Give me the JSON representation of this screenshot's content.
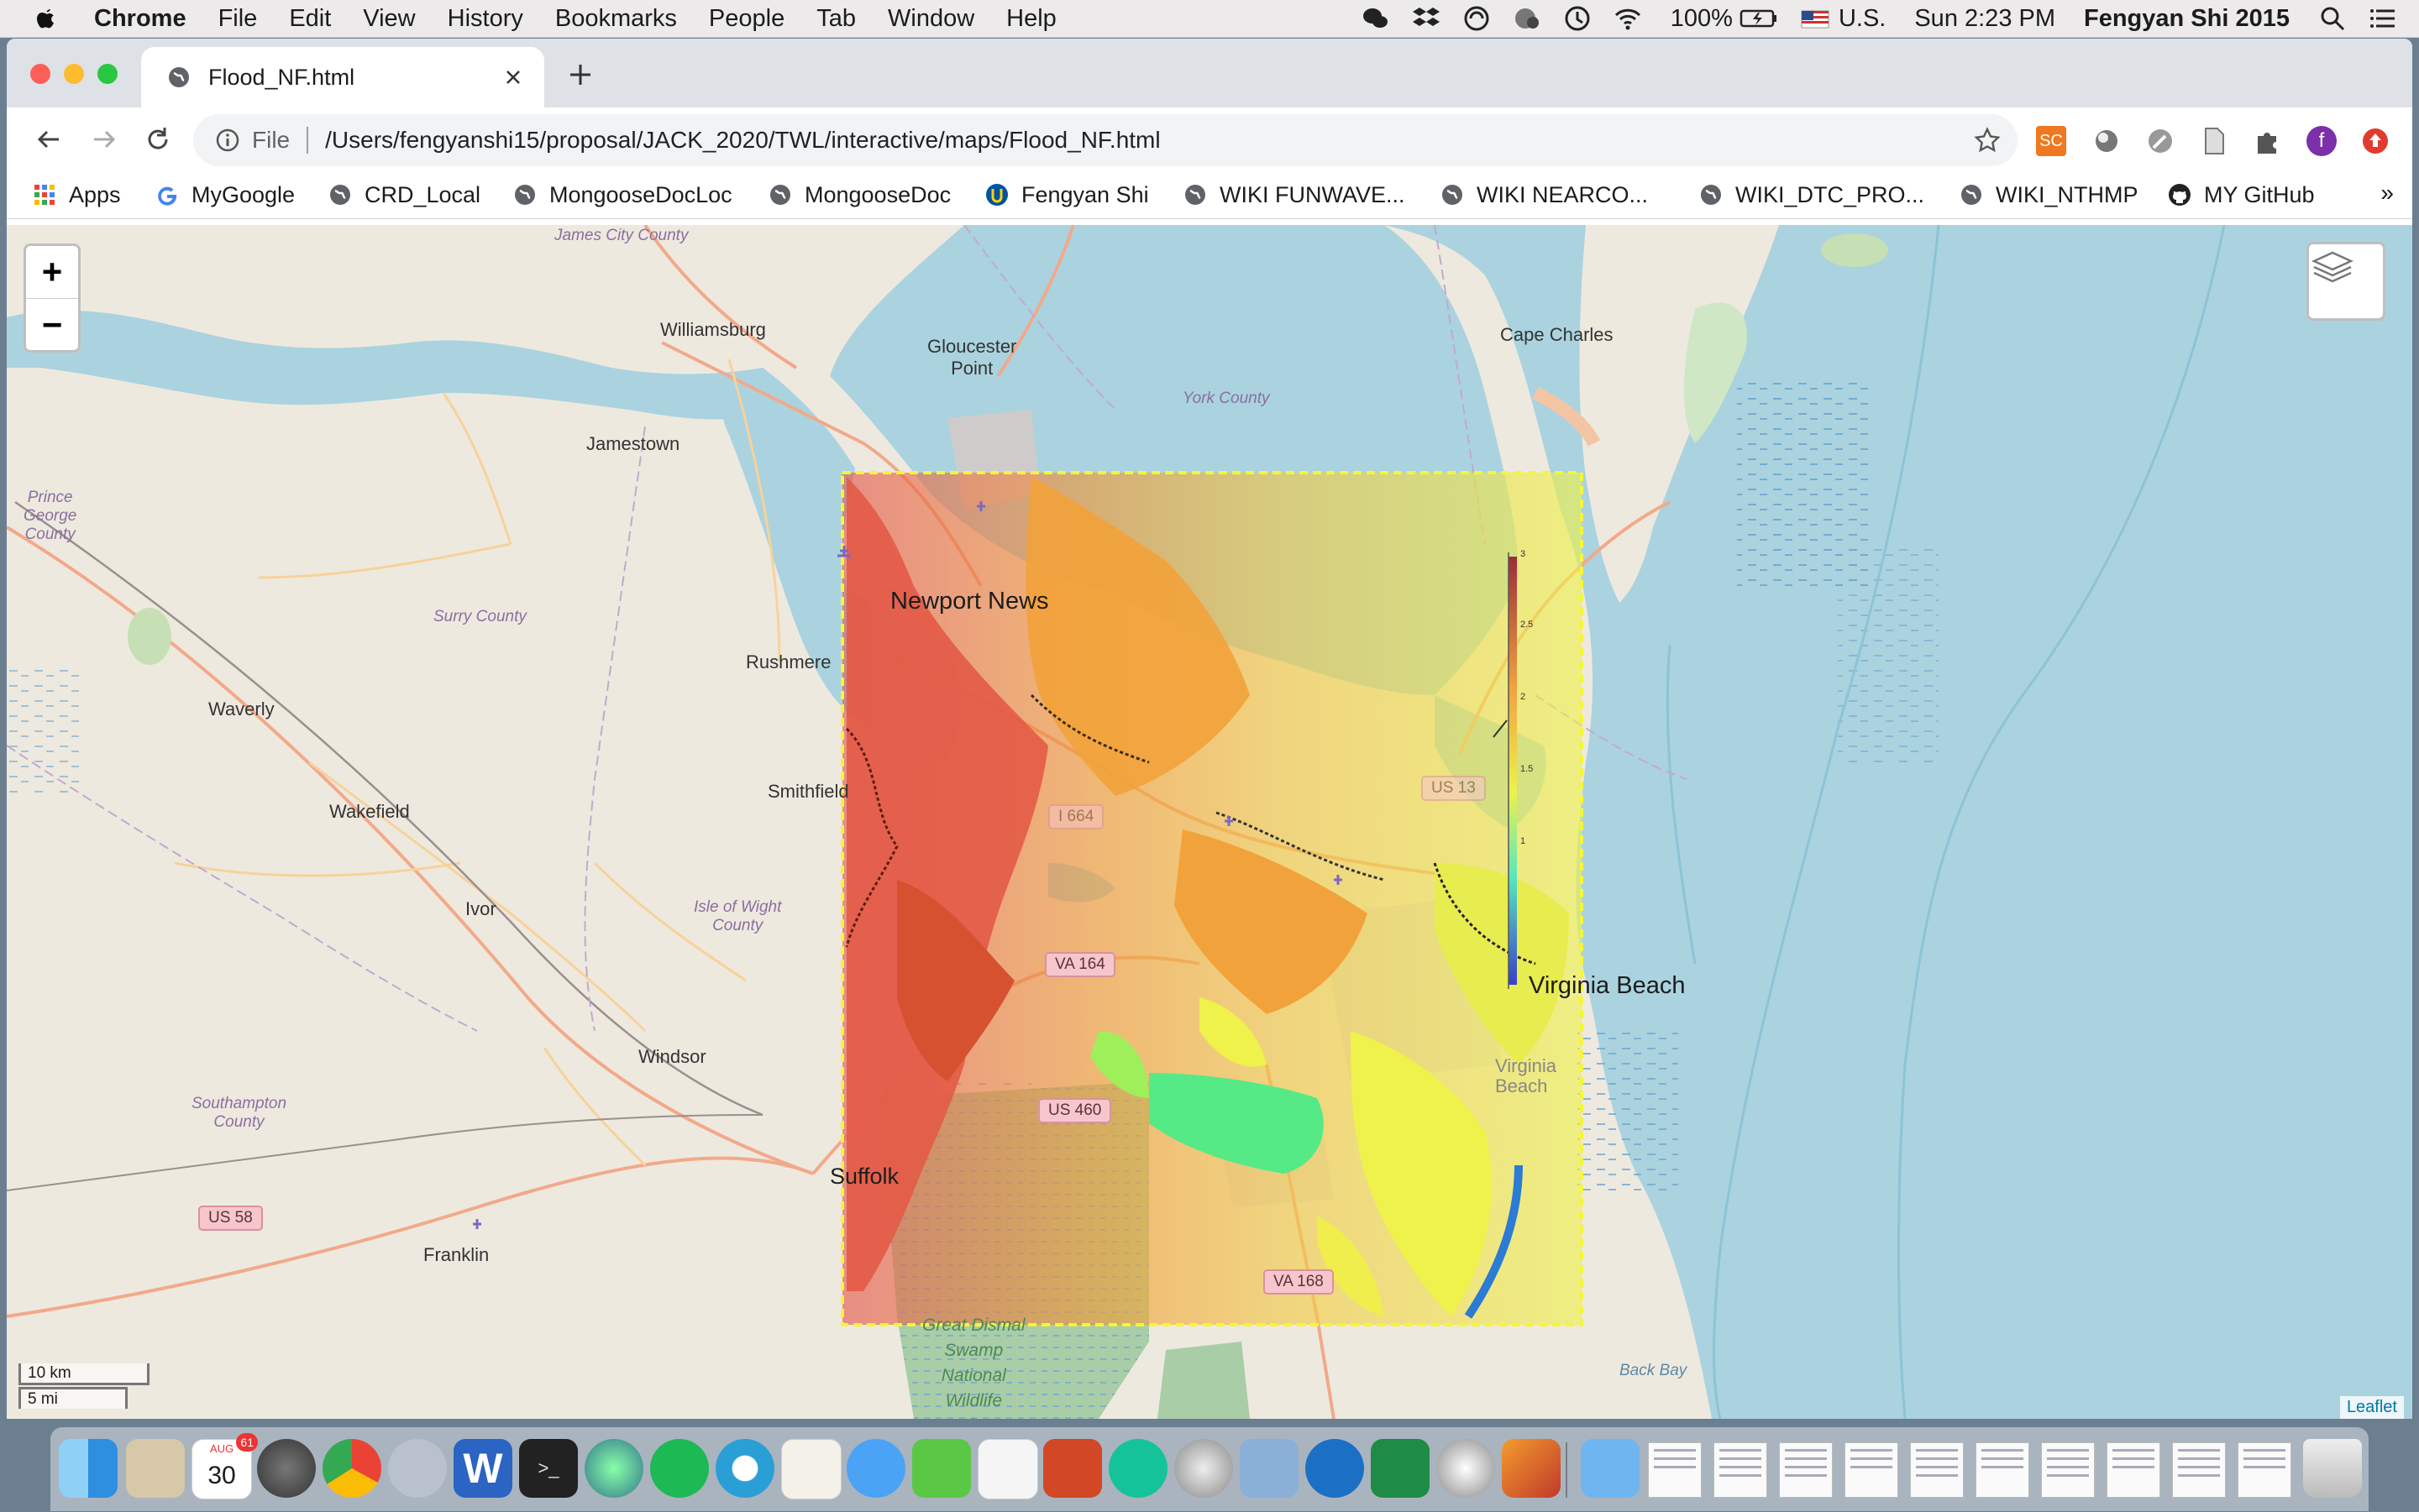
{
  "menubar": {
    "app": "Chrome",
    "items": [
      "File",
      "Edit",
      "View",
      "History",
      "Bookmarks",
      "People",
      "Tab",
      "Window",
      "Help"
    ],
    "battery": "100%",
    "input_source": "U.S.",
    "clock": "Sun 2:23 PM",
    "user": "Fengyan Shi 2015"
  },
  "tab": {
    "title": "Flood_NF.html"
  },
  "omnibox": {
    "scheme": "File",
    "url": "/Users/fengyanshi15/proposal/JACK_2020/TWL/interactive/maps/Flood_NF.html"
  },
  "bookmarks": {
    "items": [
      "Apps",
      "MyGoogle",
      "CRD_Local",
      "MongooseDocLoc",
      "MongooseDoc",
      "Fengyan Shi",
      "WIKI FUNWAVE...",
      "WIKI NEARCO...",
      "WIKI_DTC_PRO...",
      "WIKI_NTHMP",
      "MY GitHub"
    ],
    "more": "»"
  },
  "extensions": {
    "sc_label": "SC",
    "profile_initial": "f"
  },
  "map": {
    "zoom_in": "+",
    "zoom_out": "−",
    "scale_km": "10 km",
    "scale_mi": "5 mi",
    "attribution": "Leaflet",
    "places": {
      "williamsburg": "Williamsburg",
      "jamestown": "Jamestown",
      "gloucester_point": "Gloucester\nPoint",
      "cape_charles": "Cape Charles",
      "newport_news": "Newport News",
      "rushmere": "Rushmere",
      "waverly": "Waverly",
      "wakefield": "Wakefield",
      "smithfield": "Smithfield",
      "ivor": "Ivor",
      "windsor": "Windsor",
      "suffolk": "Suffolk",
      "franklin": "Franklin",
      "virginia_beach": "Virginia Beach",
      "back_bay": "Back Bay",
      "virginia_beach_faint": "Virginia\nBeach"
    },
    "counties": {
      "james_city": "James City\nCounty",
      "york": "York County",
      "prince_george": "Prince\nGeorge\nCounty",
      "surry": "Surry County",
      "isle_of_wight": "Isle of Wight\nCounty",
      "southampton": "Southampton\nCounty"
    },
    "park": "Great Dismal\nSwamp\nNational\nWildlife\nRefuge",
    "shields": {
      "va164a": "VA 164",
      "us460": "US 460",
      "us58": "US 58",
      "va168": "VA 168",
      "us13": "US 13",
      "i664": "I 664"
    },
    "colorbar": {
      "ticks": [
        "3",
        "2.5",
        "2",
        "1.5",
        "1"
      ]
    },
    "colors": {
      "water": "#aad3df",
      "land": "#eee9df",
      "flood_high": "#e4564c",
      "flood_mid": "#f4a52f",
      "flood_low": "#eef24a",
      "flood_min": "#3fe88e",
      "domain_outline": "#f5f53a"
    }
  },
  "dock": {
    "calendar_month": "AUG",
    "calendar_day": "30",
    "calendar_badge": "61"
  }
}
